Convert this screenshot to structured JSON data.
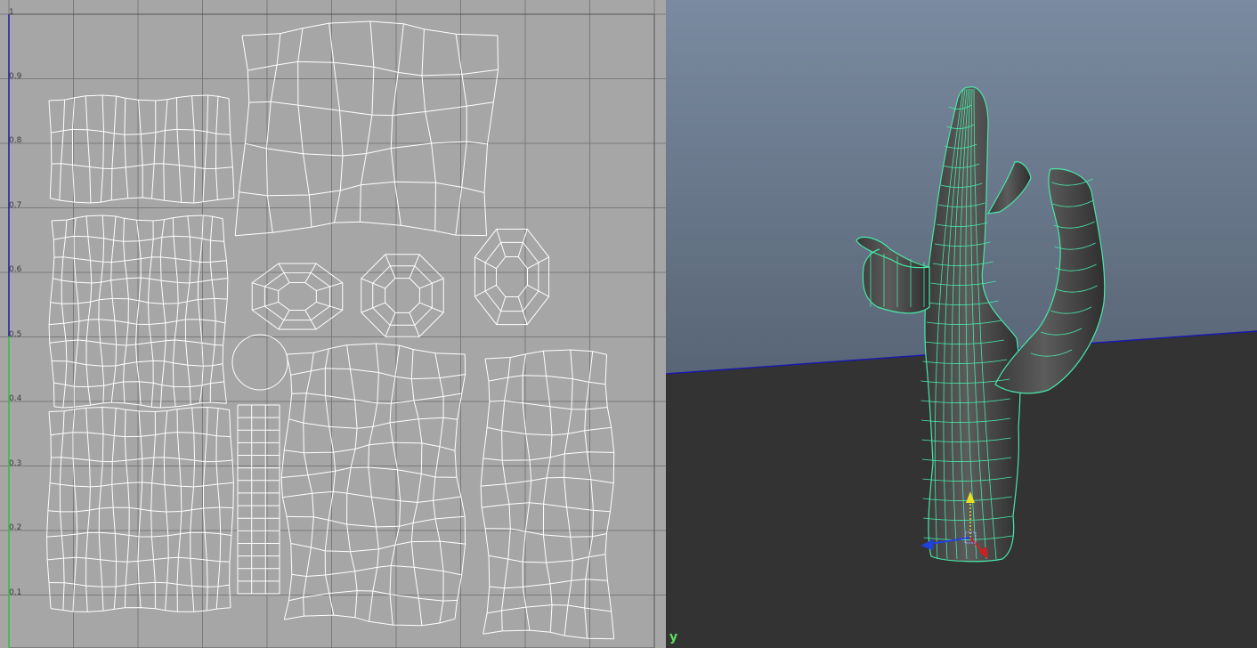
{
  "uv_editor": {
    "grid_tick_labels": [
      "1",
      "0.9",
      "0.8",
      "0.7",
      "0.6",
      "0.5",
      "0.4",
      "0.3",
      "0.2",
      "0.1"
    ],
    "background_color": "#a6a6a6",
    "grid_color": "#7a7a7a",
    "uv_wire_color": "#ffffff",
    "v_axis_upper_color": "#1a1aa8",
    "v_axis_lower_color": "#2ec42e",
    "shells": [
      "trunk-shell",
      "arm-top-shell",
      "cap-shell-1",
      "cap-shell-2",
      "cap-shell-3",
      "trunk-lower-shell",
      "circle-cap-shell",
      "ladder-strip-shell",
      "arm-left-shell",
      "arm-right-shell"
    ]
  },
  "viewport": {
    "axis_indicator_label": "y",
    "sky_top_color": "#7a8aa0",
    "sky_bottom_color": "#3f4a57",
    "ground_color": "#333333",
    "horizon_color": "#1a1aa8",
    "mesh_wire_color": "#47e8a8",
    "mesh_fill_color": "#4a4a4a",
    "manipulator": [
      "y-axis-arrow",
      "x-axis-arrow",
      "z-axis-arrow"
    ]
  }
}
